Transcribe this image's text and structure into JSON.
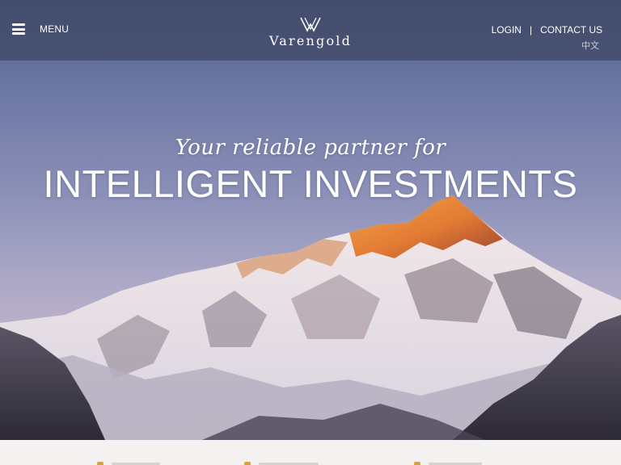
{
  "header": {
    "menu_label": "MENU",
    "logo_text": "Varengold",
    "login_label": "LOGIN",
    "separator": "|",
    "contact_label": "CONTACT US",
    "language_label": "中文"
  },
  "hero": {
    "tagline": "Your reliable partner for",
    "headline": "INTELLIGENT INVESTMENTS"
  },
  "icons": [
    "hamburger-icon",
    "varengold-logo-icon"
  ],
  "colors": {
    "topbar": "#3e4662",
    "text": "#ffffff",
    "accent": "#d6a24a",
    "bottom_strip": "#f3f2f0"
  }
}
